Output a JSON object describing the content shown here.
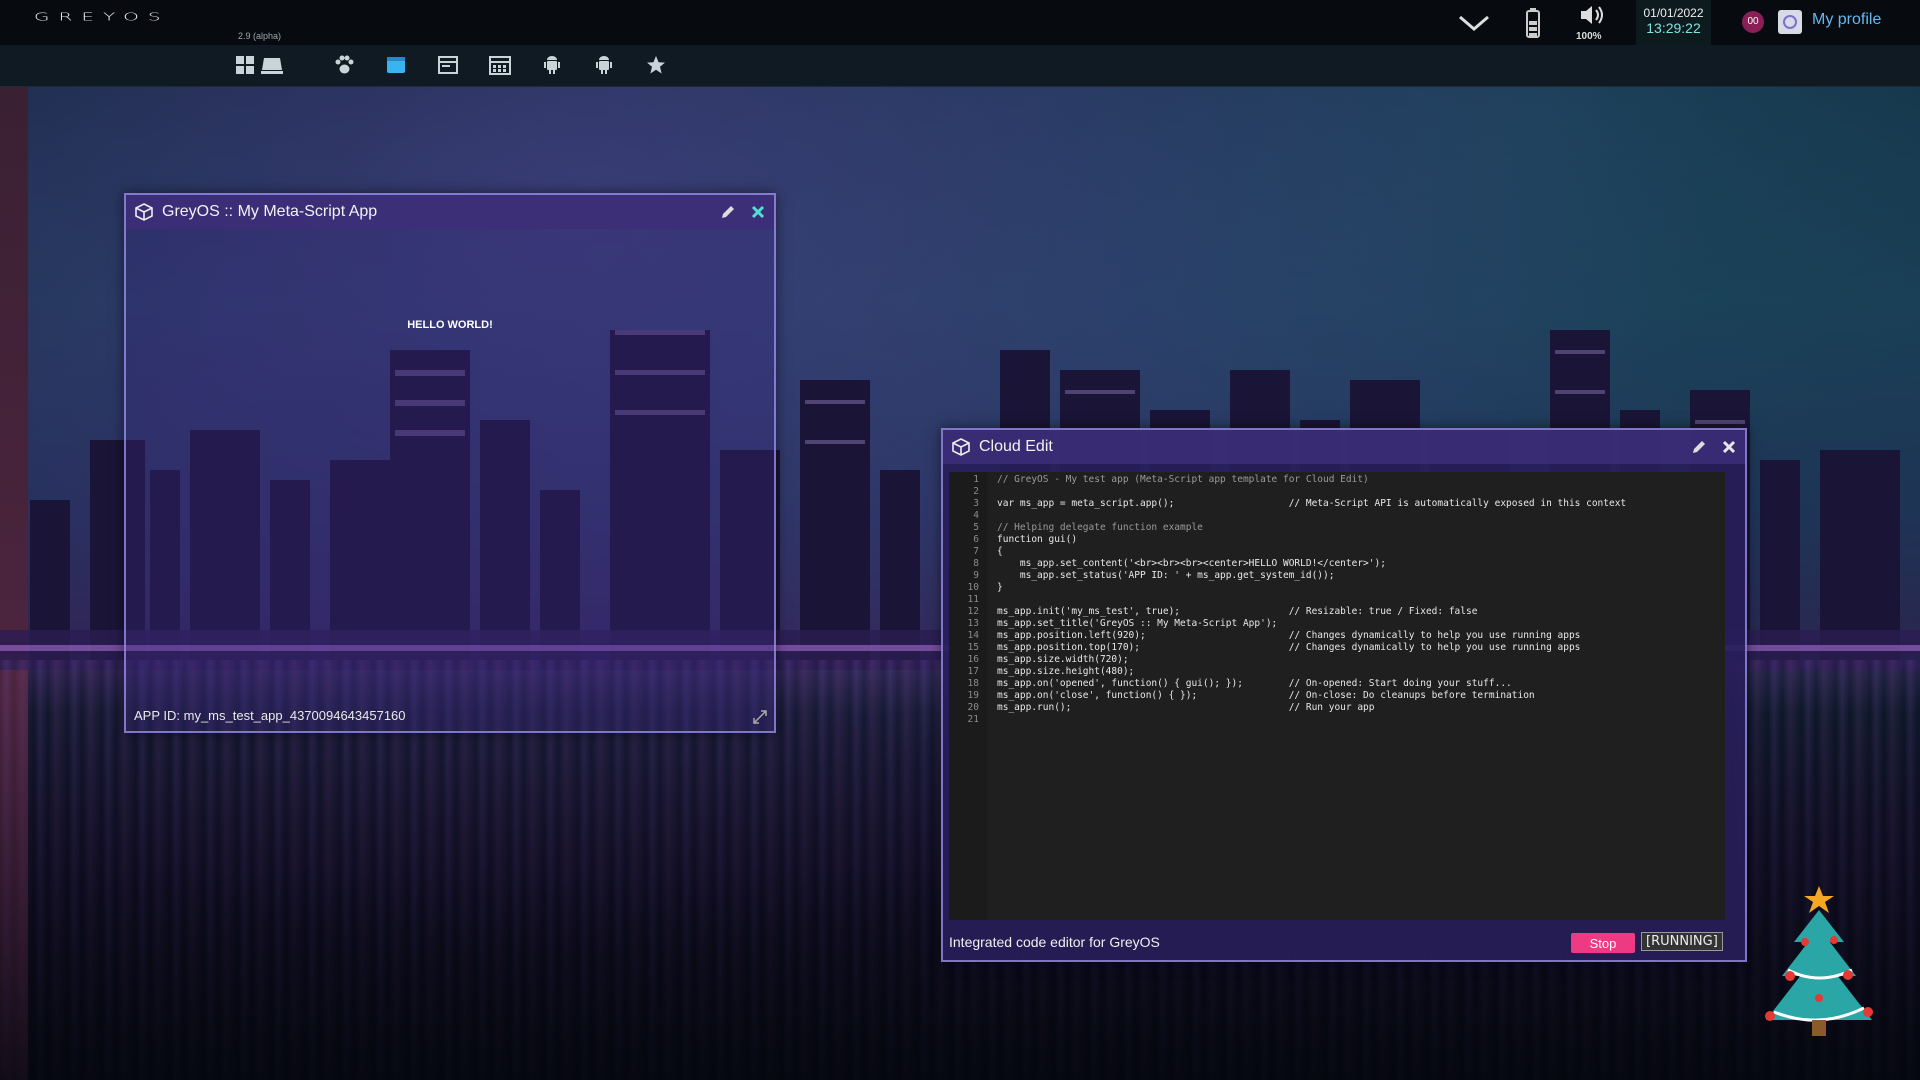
{
  "os": {
    "logo": "GREYOS",
    "version": "2.9 (alpha)"
  },
  "tray": {
    "volume_pct": "100%",
    "date": "01/01/2022",
    "time": "13:29:22",
    "notifications": "00",
    "profile_label": "My profile"
  },
  "taskbar": {
    "icons": [
      "apps-grid-icon",
      "stack-icon",
      "paw-icon",
      "window-icon",
      "browser-icon",
      "calendar-icon",
      "android-icon",
      "android-icon",
      "star-icon"
    ]
  },
  "app_window": {
    "title": "GreyOS :: My Meta-Script App",
    "content": "HELLO WORLD!",
    "status": "APP ID: my_ms_test_app_4370094643457160"
  },
  "cloud_edit": {
    "title": "Cloud Edit",
    "status": "Integrated code editor for GreyOS",
    "stop_label": "Stop",
    "state_label": "[RUNNING]",
    "code_lines": [
      "// GreyOS - My test app (Meta-Script app template for Cloud Edit)",
      "",
      "var ms_app = meta_script.app();                    // Meta-Script API is automatically exposed in this context",
      "",
      "// Helping delegate function example",
      "function gui()",
      "{",
      "    ms_app.set_content('<br><br><br><center>HELLO WORLD!</center>');",
      "    ms_app.set_status('APP ID: ' + ms_app.get_system_id());",
      "}",
      "",
      "ms_app.init('my_ms_test', true);                   // Resizable: true / Fixed: false",
      "ms_app.set_title('GreyOS :: My Meta-Script App');",
      "ms_app.position.left(920);                         // Changes dynamically to help you use running apps",
      "ms_app.position.top(170);                          // Changes dynamically to help you use running apps",
      "ms_app.size.width(720);",
      "ms_app.size.height(480);",
      "ms_app.on('opened', function() { gui(); });        // On-opened: Start doing your stuff...",
      "ms_app.on('close', function() { });                // On-close: Do cleanups before termination",
      "ms_app.run();                                      // Run your app",
      ""
    ]
  },
  "colors": {
    "accent": "#ee3a82",
    "titlebar": "#3c2d78",
    "profile": "#63b8f0"
  }
}
